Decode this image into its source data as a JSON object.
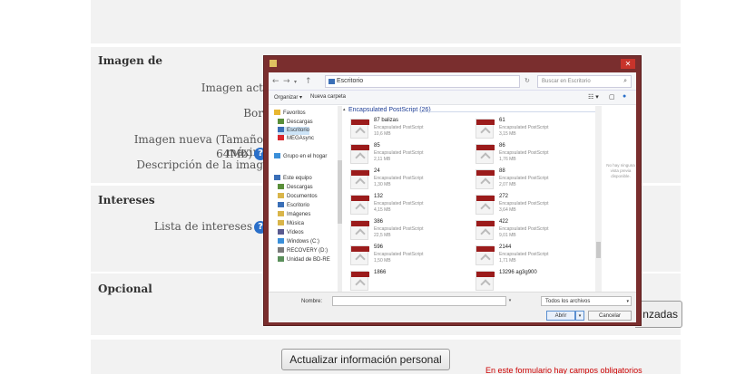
{
  "form": {
    "section_imagen": "Imagen de",
    "imagen_actual_label": "Imagen act",
    "borrar_label": "Bor",
    "imagen_nueva_label": "Imagen nueva (Tamaño máxim",
    "imagen_nueva_size": "64Mb)",
    "descripcion_label": "Descripción de la imag",
    "section_intereses": "Intereses",
    "lista_intereses_label": "Lista de intereses",
    "section_opcional": "Opcional",
    "avanzadas_button": "nzadas",
    "update_button": "Actualizar información personal",
    "footer_red": "En este formulario hay campos obligatorios"
  },
  "dialog": {
    "address_path": "Escritorio",
    "search_placeholder": "Buscar en Escritorio",
    "toolbar_organize": "Organizar ▾",
    "toolbar_new_folder": "Nueva carpeta",
    "nav_items": [
      {
        "label": "Favoritos",
        "icon": "star-icon",
        "color": "#e8b730"
      },
      {
        "label": "Descargas",
        "icon": "download-folder-icon",
        "color": "#5a8f3a"
      },
      {
        "label": "Escritorio",
        "icon": "desktop-icon",
        "color": "#3a6fb7"
      },
      {
        "label": "MEGAsync",
        "icon": "mega-icon",
        "color": "#d9272e"
      },
      {
        "label": "Grupo en el hogar",
        "icon": "homegroup-icon",
        "color": "#3a8fd9"
      },
      {
        "label": "Este equipo",
        "icon": "computer-icon",
        "color": "#3a6fb7"
      },
      {
        "label": "Descargas",
        "icon": "download-folder-icon",
        "color": "#5a8f3a"
      },
      {
        "label": "Documentos",
        "icon": "documents-icon",
        "color": "#d9b54a"
      },
      {
        "label": "Escritorio",
        "icon": "desktop-icon",
        "color": "#3a6fb7"
      },
      {
        "label": "Imágenes",
        "icon": "pictures-icon",
        "color": "#d9b54a"
      },
      {
        "label": "Música",
        "icon": "music-icon",
        "color": "#d9b54a"
      },
      {
        "label": "Vídeos",
        "icon": "videos-icon",
        "color": "#5a5a8f"
      },
      {
        "label": "Windows (C:)",
        "icon": "drive-icon",
        "color": "#3a8fd9"
      },
      {
        "label": "RECOVERY (D:)",
        "icon": "drive-icon",
        "color": "#7a7a7a"
      },
      {
        "label": "Unidad de BD-RE",
        "icon": "optical-drive-icon",
        "color": "#5a8f5a"
      }
    ],
    "group_header": "Encapsulated PostScript (26)",
    "files_left": [
      {
        "name": "87 balizas",
        "type": "Encapsulated PostScript",
        "size": "10,6 MB"
      },
      {
        "name": "85",
        "type": "Encapsulated PostScript",
        "size": "2,11 MB"
      },
      {
        "name": "24",
        "type": "Encapsulated PostScript",
        "size": "1,30 MB"
      },
      {
        "name": "132",
        "type": "Encapsulated PostScript",
        "size": "4,15 MB"
      },
      {
        "name": "386",
        "type": "Encapsulated PostScript",
        "size": "22,5 MB"
      },
      {
        "name": "596",
        "type": "Encapsulated PostScript",
        "size": "1,50 MB"
      },
      {
        "name": "1866",
        "type": "",
        "size": ""
      }
    ],
    "files_right": [
      {
        "name": "61",
        "type": "Encapsulated PostScript",
        "size": "3,15 MB"
      },
      {
        "name": "86",
        "type": "Encapsulated PostScript",
        "size": "1,76 MB"
      },
      {
        "name": "88",
        "type": "Encapsulated PostScript",
        "size": "2,07 MB"
      },
      {
        "name": "272",
        "type": "Encapsulated PostScript",
        "size": "3,64 MB"
      },
      {
        "name": "422",
        "type": "Encapsulated PostScript",
        "size": "9,01 MB"
      },
      {
        "name": "2144",
        "type": "Encapsulated PostScript",
        "size": "1,71 MB"
      },
      {
        "name": "13296 ag3g900",
        "type": "",
        "size": ""
      }
    ],
    "preview_text": "No hay ninguna vista previa disponible.",
    "filename_label": "Nombre:",
    "filter_label": "Todos los archivos",
    "open_button": "Abrir",
    "cancel_button": "Cancelar",
    "band_color": "#9b1b1b",
    "frame_color": "#7a2e2e"
  }
}
